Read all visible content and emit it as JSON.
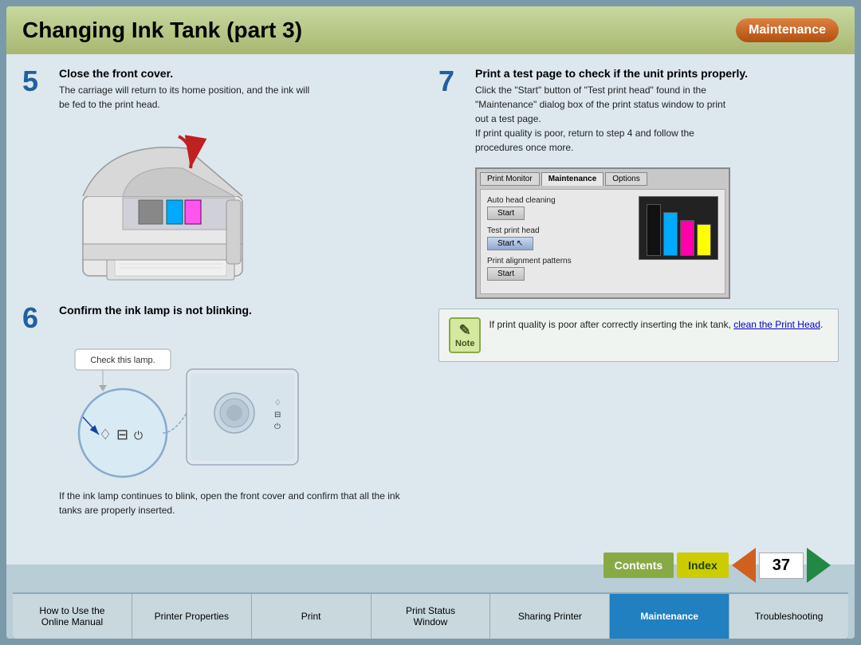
{
  "header": {
    "title": "Changing Ink Tank (part 3)",
    "badge": "Maintenance"
  },
  "steps": {
    "step5": {
      "number": "5",
      "title": "Close the front cover.",
      "desc": "The carriage will return to its home position, and the ink will\nbe fed to the print head."
    },
    "step6": {
      "number": "6",
      "title": "Confirm the ink lamp is not blinking.",
      "blink_note": "If the ink lamp continues to blink, open the front cover and\nconfirm that all the ink tanks are properly inserted.",
      "callout": "Check this lamp."
    },
    "step7": {
      "number": "7",
      "title": "Print a test page to check if the unit prints properly.",
      "desc_1": "Click the \"Start\" button of \"Test print head\" found in the\n\"Maintenance\" dialog box of the print status window to print\nout a test page.",
      "desc_2": "If print quality is poor, return to step 4 and follow the\nprocedures once more."
    }
  },
  "dialog": {
    "tabs": [
      "Print Monitor",
      "Maintenance",
      "Options"
    ],
    "active_tab": "Maintenance",
    "sections": [
      {
        "label": "Auto head cleaning",
        "btn": "Start",
        "highlighted": false
      },
      {
        "label": "Test print head",
        "btn": "Start",
        "highlighted": true
      },
      {
        "label": "Print alignment patterns",
        "btn": "Start",
        "highlighted": false
      }
    ]
  },
  "note": {
    "icon_label": "Note",
    "text_before": "If print quality is poor after correctly inserting the ink\ntank, ",
    "link_text": "clean the Print Head",
    "text_after": "."
  },
  "page_controls": {
    "contents_label": "Contents",
    "index_label": "Index",
    "page_number": "37"
  },
  "nav": {
    "items": [
      {
        "id": "how-to-use",
        "label": "How to Use the\nOnline Manual",
        "active": false
      },
      {
        "id": "printer-properties",
        "label": "Printer Properties",
        "active": false
      },
      {
        "id": "print",
        "label": "Print",
        "active": false
      },
      {
        "id": "print-status-window",
        "label": "Print Status\nWindow",
        "active": false
      },
      {
        "id": "sharing-printer",
        "label": "Sharing Printer",
        "active": false
      },
      {
        "id": "maintenance",
        "label": "Maintenance",
        "active": true
      },
      {
        "id": "troubleshooting",
        "label": "Troubleshooting",
        "active": false
      }
    ]
  }
}
